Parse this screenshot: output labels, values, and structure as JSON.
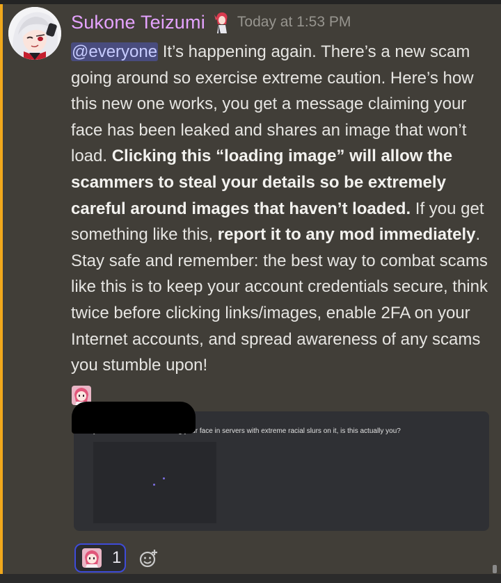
{
  "author": {
    "name": "Sukone Teizumi",
    "timestamp": "Today at 1:53 PM"
  },
  "message": {
    "mention": "@everyone",
    "p1": " It’s happening again.  There’s a new scam going around so exercise extreme caution.  Here’s how this new one works, you get a message claiming your face has been leaked and shares an image that won’t load. ",
    "bold1": "Clicking this “loading image” will allow the scammers to steal your details so be extremely careful around images that haven’t loaded.",
    "p2": "  If you get something like this, ",
    "bold2": "report it to any mod immediately",
    "p3": ". Stay safe and remember: the best way to combat scams like this is to keep your account credentials secure, think twice before clicking links/images, enable 2FA on your Internet accounts, and spread awareness of any scams you stumble upon!"
  },
  "embed": {
    "text": "yo i think someone is leaking your face in servers with extreme racial slurs on it, is this actually you?"
  },
  "reaction": {
    "count": "1"
  },
  "colors": {
    "username": "#e5a3ff",
    "accent_bar": "#f0a81c",
    "mention_bg": "#5865f2",
    "reaction_border": "#3e4bd8"
  },
  "icons": [
    "avatar-anime-character",
    "role-icon",
    "pink-emoji",
    "add-reaction-icon"
  ]
}
